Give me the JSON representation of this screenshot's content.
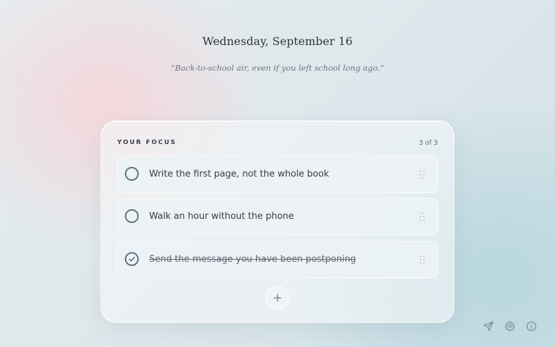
{
  "header": {
    "date": "Wednesday, September 16",
    "quote": "“Back-to-school air, even if you left school long ago.”"
  },
  "focus": {
    "title": "YOUR FOCUS",
    "count": "3 of 3",
    "tasks": [
      {
        "label": "Write the first page, not the whole book",
        "done": false
      },
      {
        "label": "Walk an hour without the phone",
        "done": false
      },
      {
        "label": "Send the message you have been postponing",
        "done": true
      }
    ],
    "add_icon": "plus-icon"
  },
  "footer_icons": [
    "send-icon",
    "gear-icon",
    "info-icon"
  ],
  "colors": {
    "accent": "#5f7183",
    "text": "#353c45",
    "muted": "#66707b"
  }
}
